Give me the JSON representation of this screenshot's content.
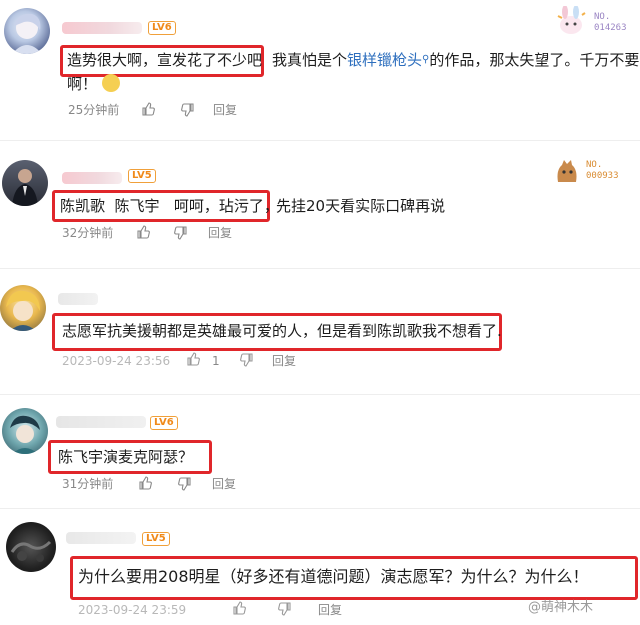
{
  "comments": [
    {
      "level": "LV6",
      "text_hl": "造势很大啊，宣发花了不少吧",
      "text_rest": "我真怕是个",
      "link": "银样镴枪头",
      "text_after": "的作品，那太失望了。千万不要",
      "text_line2": "啊！",
      "time": "25分钟前",
      "reply": "回复",
      "badge_label": "NO.",
      "badge_num": "014263"
    },
    {
      "level": "LV5",
      "text_hl": "陈凯歌  陈飞宇   呵呵，玷污了，",
      "text_rest": "先挂20天看实际口碑再说",
      "time": "32分钟前",
      "reply": "回复",
      "badge_label": "NO.",
      "badge_num": "000933"
    },
    {
      "text_hl": "志愿军抗美援朝都是英雄最可爱的人，但是看到陈凯歌我不想看了.",
      "time": "2023-09-24 23:56",
      "like_count": "1",
      "reply": "回复"
    },
    {
      "level": "LV6",
      "text_hl": "陈飞宇演麦克阿瑟？",
      "time": "31分钟前",
      "reply": "回复"
    },
    {
      "level": "LV5",
      "text_hl": "为什么要用208明星（好多还有道德问题）演志愿军？为什么？为什么！",
      "time": "2023-09-24 23:59",
      "reply": "回复"
    }
  ],
  "watermark": "@萌神木木"
}
